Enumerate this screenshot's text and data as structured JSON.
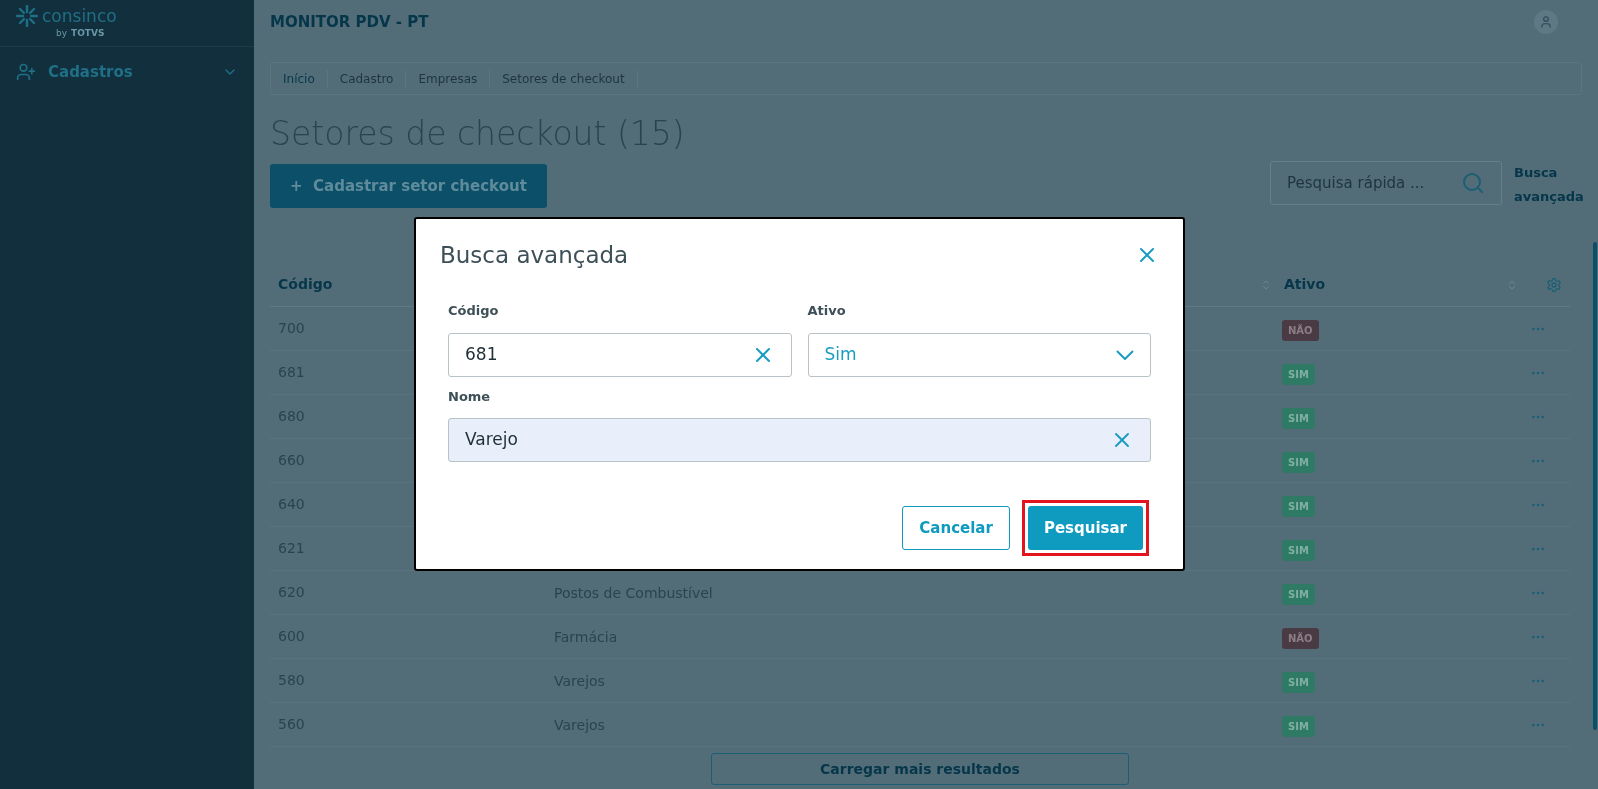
{
  "sidebar": {
    "logo_text": "consinco",
    "logo_sub": "by",
    "logo_brand": "TOTVS",
    "items": [
      {
        "label": "Cadastros",
        "expanded": false
      }
    ]
  },
  "header": {
    "title": "MONITOR PDV - PT"
  },
  "breadcrumb": [
    "Início",
    "Cadastro",
    "Empresas",
    "Setores de checkout"
  ],
  "page_title": "Setores de checkout (15)",
  "add_button": "+  Cadastrar setor checkout",
  "search": {
    "placeholder": "Pesquisa rápida ..."
  },
  "advanced_link": "Busca avançada",
  "table": {
    "columns": [
      "Código",
      "Ativo"
    ],
    "rows": [
      {
        "code": "700",
        "active": false,
        "badge": "NÃO"
      },
      {
        "code": "681",
        "active": true,
        "badge": "SIM"
      },
      {
        "code": "680",
        "active": true,
        "badge": "SIM"
      },
      {
        "code": "660",
        "active": true,
        "badge": "SIM"
      },
      {
        "code": "640",
        "active": true,
        "badge": "SIM"
      },
      {
        "code": "621",
        "active": true,
        "badge": "SIM"
      },
      {
        "code": "620",
        "name": "Postos de Combustível",
        "active": true,
        "badge": "SIM"
      },
      {
        "code": "600",
        "name": "Farmácia",
        "active": false,
        "badge": "NÃO"
      },
      {
        "code": "580",
        "name": "Varejos",
        "active": true,
        "badge": "SIM"
      },
      {
        "code": "560",
        "name": "Varejos",
        "active": true,
        "badge": "SIM"
      }
    ]
  },
  "load_more": "Carregar mais resultados",
  "dialog": {
    "title": "Busca avançada",
    "fields": [
      {
        "kind": "text",
        "label": "Código",
        "value": "681",
        "filled": false
      },
      {
        "kind": "select",
        "label": "Ativo",
        "value": "Sim"
      },
      {
        "kind": "text",
        "label": "Nome",
        "value": "Varejo",
        "filled": true
      }
    ],
    "buttons": [
      {
        "label": "Cancelar",
        "kind": "secondary",
        "highlighted": false
      },
      {
        "label": "Pesquisar",
        "kind": "primary",
        "highlighted": true
      }
    ]
  }
}
